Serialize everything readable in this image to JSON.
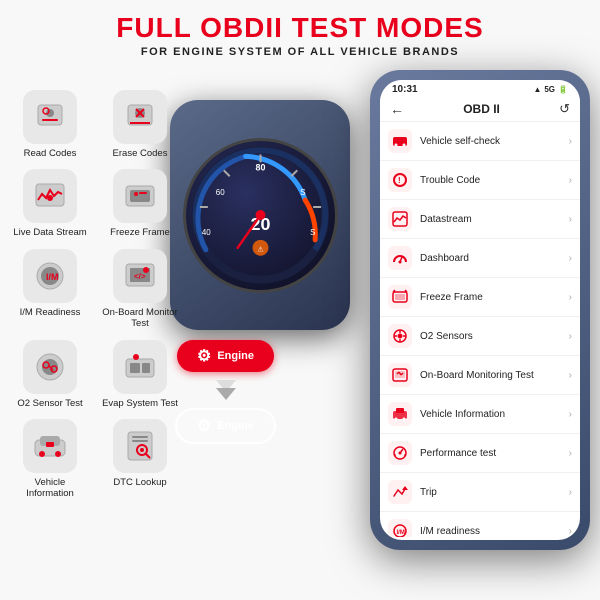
{
  "header": {
    "title": "FULL OBDII TEST MODES",
    "subtitle": "FOR ENGINE SYSTEM OF ALL VEHICLE BRANDS"
  },
  "left_icons": [
    {
      "label": "Read Codes",
      "icon": "read-codes-icon",
      "color": "#e0e0e0"
    },
    {
      "label": "Erase Codes",
      "icon": "erase-codes-icon",
      "color": "#e0e0e0"
    },
    {
      "label": "Live Data Stream",
      "icon": "live-data-icon",
      "color": "#e0e0e0"
    },
    {
      "label": "Freeze Frame",
      "icon": "freeze-frame-icon",
      "color": "#e0e0e0"
    },
    {
      "label": "I/M Readiness",
      "icon": "im-readiness-icon",
      "color": "#e0e0e0"
    },
    {
      "label": "On-Board Monitor Test",
      "icon": "onboard-monitor-icon",
      "color": "#e0e0e0"
    },
    {
      "label": "O2 Sensor Test",
      "icon": "o2-sensor-icon",
      "color": "#e0e0e0"
    },
    {
      "label": "Evap System Test",
      "icon": "evap-system-icon",
      "color": "#e0e0e0"
    },
    {
      "label": "Vehicle Information",
      "icon": "vehicle-info-icon",
      "color": "#e0e0e0"
    },
    {
      "label": "DTC Lookup",
      "icon": "dtc-lookup-icon",
      "color": "#e0e0e0"
    }
  ],
  "phone": {
    "status": {
      "time": "10:31",
      "signal": "5G",
      "battery": "▮"
    },
    "title": "OBD II",
    "back_icon": "←",
    "refresh_icon": "↺",
    "menu_items": [
      {
        "label": "Vehicle self-check",
        "icon": "vehicle-selfcheck-icon",
        "icon_color": "#e8001c"
      },
      {
        "label": "Trouble Code",
        "icon": "trouble-code-icon",
        "icon_color": "#e8001c"
      },
      {
        "label": "Datastream",
        "icon": "datastream-icon",
        "icon_color": "#e8001c"
      },
      {
        "label": "Dashboard",
        "icon": "dashboard-icon",
        "icon_color": "#e8001c"
      },
      {
        "label": "Freeze Frame",
        "icon": "freeze-frame-phone-icon",
        "icon_color": "#e8001c"
      },
      {
        "label": "O2 Sensors",
        "icon": "o2-sensors-icon",
        "icon_color": "#e8001c"
      },
      {
        "label": "On-Board Monitoring Test",
        "icon": "onboard-monitoring-icon",
        "icon_color": "#e8001c"
      },
      {
        "label": "Vehicle Information",
        "icon": "vehicle-info-phone-icon",
        "icon_color": "#e8001c"
      },
      {
        "label": "Performance test",
        "icon": "performance-test-icon",
        "icon_color": "#e8001c"
      },
      {
        "label": "Trip",
        "icon": "trip-icon",
        "icon_color": "#e8001c"
      },
      {
        "label": "I/M readiness",
        "icon": "im-readiness-phone-icon",
        "icon_color": "#e8001c"
      }
    ]
  },
  "engine": {
    "label1": "Engine",
    "label2": "Engine"
  },
  "colors": {
    "red": "#e8001c",
    "dark_blue": "#2a3450",
    "light_bg": "#f8f8f8"
  }
}
